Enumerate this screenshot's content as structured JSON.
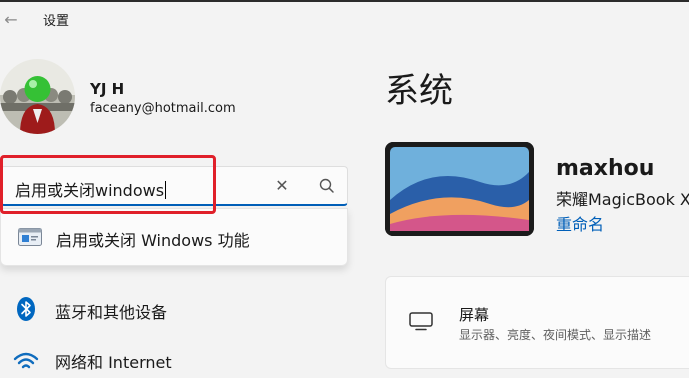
{
  "window": {
    "title": "设置",
    "back_icon": "arrow-left-icon"
  },
  "user": {
    "name": "YJ H",
    "email": "faceany@hotmail.com"
  },
  "search": {
    "value": "启用或关闭windows",
    "clear_icon": "close-icon",
    "search_icon": "search-icon",
    "suggestions": [
      {
        "label": "启用或关闭 Windows 功能",
        "icon": "windows-features-icon"
      }
    ]
  },
  "sidebar": {
    "items": [
      {
        "label": "蓝牙和其他设备",
        "icon": "bluetooth-icon"
      },
      {
        "label": "网络和 Internet",
        "icon": "wifi-icon"
      }
    ]
  },
  "main": {
    "title": "系统",
    "device": {
      "name": "maxhou",
      "model": "荣耀MagicBook X",
      "rename_label": "重命名"
    },
    "cards": [
      {
        "title": "屏幕",
        "subtitle": "显示器、亮度、夜间模式、显示描述",
        "icon": "monitor-icon"
      }
    ]
  },
  "colors": {
    "accent": "#005fb8",
    "highlight_box": "#e0202a",
    "bluetooth": "#0067c0"
  }
}
